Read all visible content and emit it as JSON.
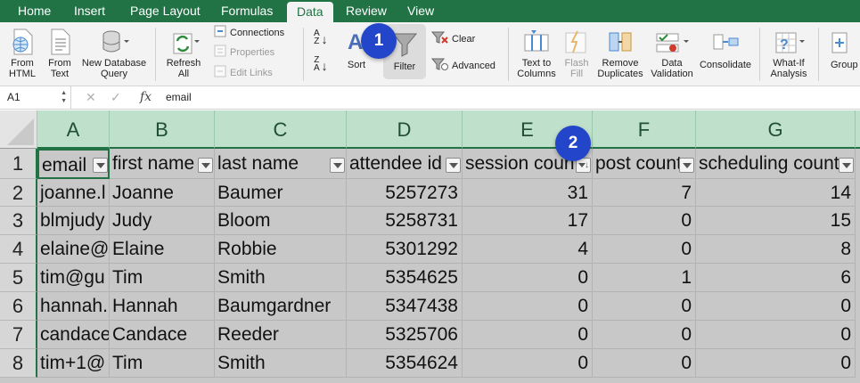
{
  "tabs": [
    "Home",
    "Insert",
    "Page Layout",
    "Formulas",
    "Data",
    "Review",
    "View"
  ],
  "active_tab": "Data",
  "ribbon": {
    "from_html": [
      "From",
      "HTML"
    ],
    "from_text": [
      "From",
      "Text"
    ],
    "new_database_query": [
      "New Database",
      "Query"
    ],
    "refresh_all": [
      "Refresh",
      "All"
    ],
    "connections": "Connections",
    "properties": "Properties",
    "edit_links": "Edit Links",
    "sort": "Sort",
    "filter": "Filter",
    "clear": "Clear",
    "advanced": "Advanced",
    "text_to_columns": [
      "Text to",
      "Columns"
    ],
    "flash_fill": [
      "Flash",
      "Fill"
    ],
    "remove_duplicates": [
      "Remove",
      "Duplicates"
    ],
    "data_validation": [
      "Data",
      "Validation"
    ],
    "consolidate": "Consolidate",
    "what_if_analysis": [
      "What-If",
      "Analysis"
    ],
    "group": "Group"
  },
  "callouts": [
    "1",
    "2"
  ],
  "formula_bar": {
    "name_box": "A1",
    "fx": "fx",
    "content": "email"
  },
  "columns": [
    "A",
    "B",
    "C",
    "D",
    "E",
    "F",
    "G"
  ],
  "row_numbers": [
    "1",
    "2",
    "3",
    "4",
    "5",
    "6",
    "7",
    "8"
  ],
  "header_row": [
    "email",
    "first name",
    "last name",
    "attendee id",
    "session count",
    "post count",
    "scheduling count"
  ],
  "rows": [
    [
      "joanne.l",
      "Joanne",
      "Baumer",
      "5257273",
      "31",
      "7",
      "14"
    ],
    [
      "blmjudy",
      "Judy",
      "Bloom",
      "5258731",
      "17",
      "0",
      "15"
    ],
    [
      "elaine@",
      "Elaine",
      "Robbie",
      "5301292",
      "4",
      "0",
      "8"
    ],
    [
      "tim@gu",
      "Tim",
      "Smith",
      "5354625",
      "0",
      "1",
      "6"
    ],
    [
      "hannah.",
      "Hannah",
      "Baumgardner",
      "5347438",
      "0",
      "0",
      "0"
    ],
    [
      "candace",
      "Candace",
      "Reeder",
      "5325706",
      "0",
      "0",
      "0"
    ],
    [
      "tim+1@",
      "Tim",
      "Smith",
      "5354624",
      "0",
      "0",
      "0"
    ]
  ],
  "colors": {
    "excel_green": "#217346",
    "callout_blue": "#2345c9",
    "grid_gray": "#c8c8c8",
    "column_header_green": "#bfe0ca"
  }
}
